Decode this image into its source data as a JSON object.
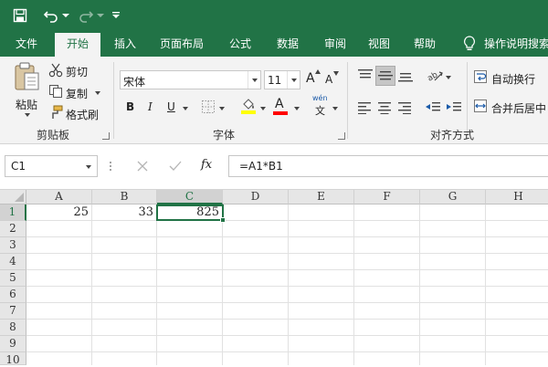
{
  "tabs": [
    {
      "label": "文件"
    },
    {
      "label": "开始"
    },
    {
      "label": "插入"
    },
    {
      "label": "页面布局"
    },
    {
      "label": "公式"
    },
    {
      "label": "数据"
    },
    {
      "label": "审阅"
    },
    {
      "label": "视图"
    },
    {
      "label": "帮助"
    }
  ],
  "active_tab": "开始",
  "tell_me": "操作说明搜索",
  "clipboard": {
    "paste": "粘贴",
    "cut": "剪切",
    "copy": "复制",
    "format_painter": "格式刷",
    "group_label": "剪贴板"
  },
  "font": {
    "font_name": "宋体",
    "font_size": "11",
    "bold": "B",
    "italic": "I",
    "underline": "U",
    "grow": "A",
    "shrink": "A",
    "font_color_glyph": "A",
    "phonetic_top": "wén",
    "phonetic_bottom": "文",
    "group_label": "字体"
  },
  "alignment": {
    "wrap_text": "自动换行",
    "merge_center": "合并后居中",
    "group_label": "对齐方式"
  },
  "formula_bar": {
    "name_box": "C1",
    "fx": "fx",
    "formula": "=A1*B1"
  },
  "grid": {
    "columns": [
      "A",
      "B",
      "C",
      "D",
      "E",
      "F",
      "G",
      "H"
    ],
    "rows": [
      "1",
      "2",
      "3",
      "4",
      "5",
      "6",
      "7",
      "8",
      "9",
      "10"
    ],
    "cells": {
      "A1": "25",
      "B1": "33",
      "C1": "825"
    },
    "active_cell": "C1"
  },
  "colors": {
    "brand": "#217346",
    "ribbon_bg": "#f3f3f3",
    "highlight_yellow": "#ffff00",
    "font_red": "#ff0000"
  }
}
